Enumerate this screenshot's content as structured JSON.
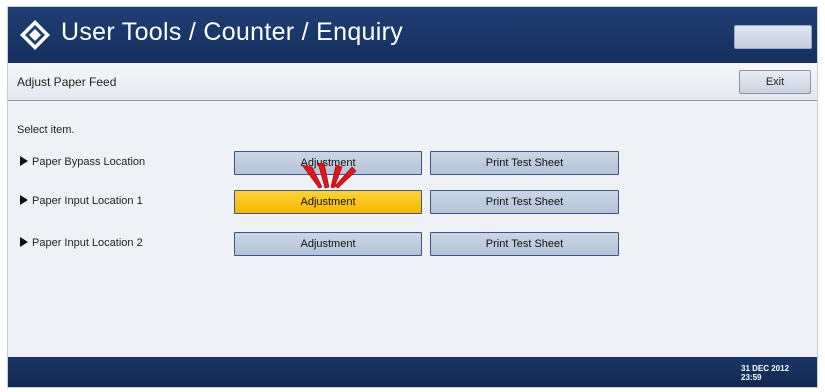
{
  "header": {
    "title": "User Tools / Counter / Enquiry",
    "right_button_label": "",
    "logo_icon": "diamond-logo-icon"
  },
  "subheader": {
    "title": "Adjust Paper Feed",
    "exit_label": "Exit"
  },
  "content": {
    "prompt": "Select item.",
    "rows": [
      {
        "label": "Paper Bypass Location",
        "adjust_label": "Adjustment",
        "print_label": "Print Test Sheet",
        "selected": false
      },
      {
        "label": "Paper Input Location 1",
        "adjust_label": "Adjustment",
        "print_label": "Print Test Sheet",
        "selected": true
      },
      {
        "label": "Paper Input Location 2",
        "adjust_label": "Adjustment",
        "print_label": "Print Test Sheet",
        "selected": false
      }
    ]
  },
  "footer": {
    "date": "31 DEC 2012",
    "time": "23:59"
  },
  "colors": {
    "header_bg": "#1f3e74",
    "selected_button": "#f5b800",
    "pointer": "#e0141c"
  }
}
